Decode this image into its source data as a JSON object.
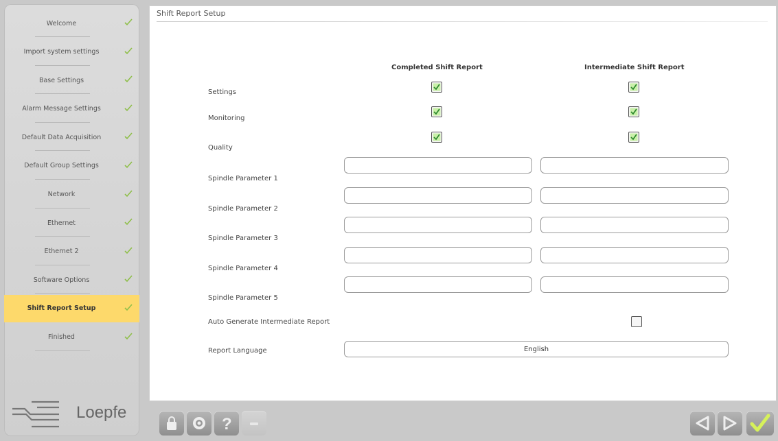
{
  "sidebar": {
    "items": [
      {
        "label": "Welcome"
      },
      {
        "label": "Import system settings"
      },
      {
        "label": "Base Settings"
      },
      {
        "label": "Alarm Message Settings"
      },
      {
        "label": "Default Data Acquisition"
      },
      {
        "label": "Default Group Settings"
      },
      {
        "label": "Network"
      },
      {
        "label": "Ethernet"
      },
      {
        "label": "Ethernet 2"
      },
      {
        "label": "Software Options"
      },
      {
        "label": "Shift Report Setup"
      },
      {
        "label": "Finished"
      }
    ],
    "active_index": 10,
    "logo_text": "Loepfe"
  },
  "main": {
    "title": "Shift Report Setup",
    "columns": {
      "completed": "Completed Shift Report",
      "intermediate": "Intermediate Shift Report"
    },
    "checkbox_rows": [
      {
        "label": "Settings",
        "completed": true,
        "intermediate": true
      },
      {
        "label": "Monitoring",
        "completed": true,
        "intermediate": true
      },
      {
        "label": "Quality",
        "completed": true,
        "intermediate": true
      }
    ],
    "param_rows": [
      {
        "label": "Spindle Parameter 1",
        "completed": "",
        "intermediate": ""
      },
      {
        "label": "Spindle Parameter 2",
        "completed": "",
        "intermediate": ""
      },
      {
        "label": "Spindle Parameter 3",
        "completed": "",
        "intermediate": ""
      },
      {
        "label": "Spindle Parameter 4",
        "completed": "",
        "intermediate": ""
      },
      {
        "label": "Spindle Parameter 5",
        "completed": "",
        "intermediate": ""
      }
    ],
    "auto_generate": {
      "label": "Auto Generate Intermediate Report",
      "checked": false
    },
    "report_language": {
      "label": "Report Language",
      "value": "English"
    }
  },
  "toolbar": {
    "icons": [
      "lock-icon",
      "globe-icon",
      "help-icon",
      "disabled-icon"
    ],
    "nav": [
      "back-icon",
      "forward-icon",
      "finish-check-icon"
    ]
  },
  "colors": {
    "active_item": "#fdd96b",
    "check_green": "#7cbf3a",
    "checkbox_fill": "#c9f0a8"
  }
}
